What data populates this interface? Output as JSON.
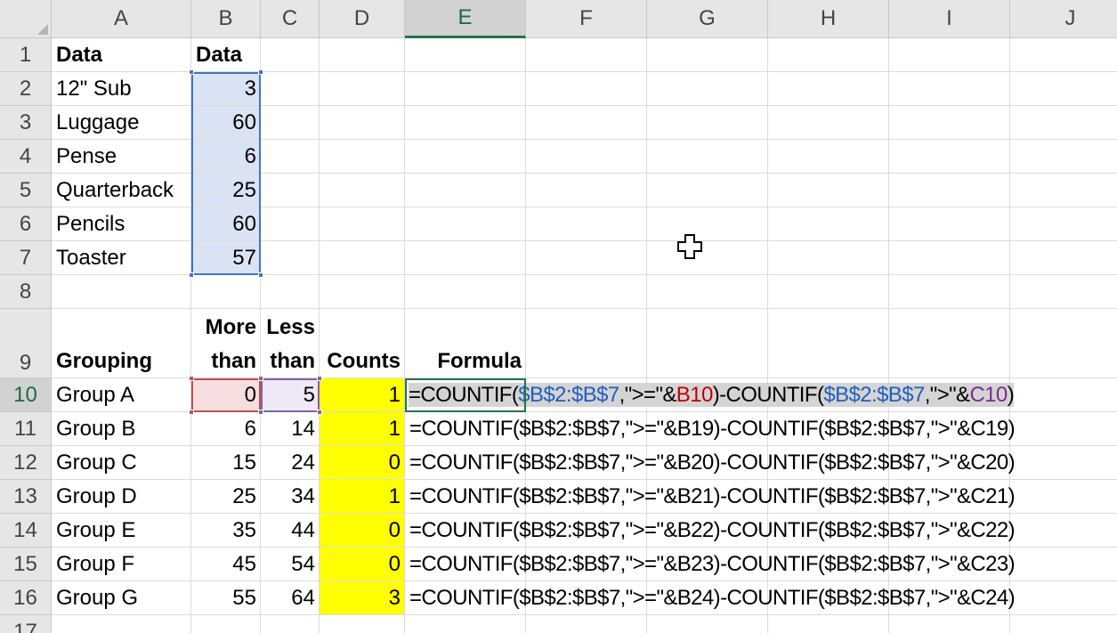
{
  "columns": [
    "A",
    "B",
    "C",
    "D",
    "E",
    "F",
    "G",
    "H",
    "I",
    "J"
  ],
  "rows": [
    "1",
    "2",
    "3",
    "4",
    "5",
    "6",
    "7",
    "8",
    "9",
    "10",
    "11",
    "12",
    "13",
    "14",
    "15",
    "16",
    "17"
  ],
  "selected": {
    "column": "E",
    "row": "10"
  },
  "data_header": {
    "a1": "Data",
    "b1": "Data"
  },
  "data_rows": [
    {
      "name": "12\" Sub",
      "value": "3"
    },
    {
      "name": "Luggage",
      "value": "60"
    },
    {
      "name": "Pense",
      "value": "6"
    },
    {
      "name": "Quarterback",
      "value": "25"
    },
    {
      "name": "Pencils",
      "value": "60"
    },
    {
      "name": "Toaster",
      "value": "57"
    }
  ],
  "group_header": {
    "grouping": "Grouping",
    "more_line1": "More",
    "more_line2": "than",
    "less_line1": "Less",
    "less_line2": "than",
    "counts": "Counts",
    "formula": "Formula"
  },
  "active_formula": {
    "p1": "=COUNTIF(",
    "r1": "$B$2:$B$7",
    "p2": ",\">=\"&",
    "r2": "B10",
    "p3": ")-COUNTIF(",
    "r3": "$B$2:$B$7",
    "p4": ",\">\"&",
    "r4": "C10",
    "p5": ")"
  },
  "groups": [
    {
      "name": "Group A",
      "more": "0",
      "less": "5",
      "count": "1",
      "formula": ""
    },
    {
      "name": "Group B",
      "more": "6",
      "less": "14",
      "count": "1",
      "formula": "=COUNTIF($B$2:$B$7,\">=\"&B19)-COUNTIF($B$2:$B$7,\">\"&C19)"
    },
    {
      "name": "Group C",
      "more": "15",
      "less": "24",
      "count": "0",
      "formula": "=COUNTIF($B$2:$B$7,\">=\"&B20)-COUNTIF($B$2:$B$7,\">\"&C20)"
    },
    {
      "name": "Group D",
      "more": "25",
      "less": "34",
      "count": "1",
      "formula": "=COUNTIF($B$2:$B$7,\">=\"&B21)-COUNTIF($B$2:$B$7,\">\"&C21)"
    },
    {
      "name": "Group E",
      "more": "35",
      "less": "44",
      "count": "0",
      "formula": "=COUNTIF($B$2:$B$7,\">=\"&B22)-COUNTIF($B$2:$B$7,\">\"&C22)"
    },
    {
      "name": "Group F",
      "more": "45",
      "less": "54",
      "count": "0",
      "formula": "=COUNTIF($B$2:$B$7,\">=\"&B23)-COUNTIF($B$2:$B$7,\">\"&C23)"
    },
    {
      "name": "Group G",
      "more": "55",
      "less": "64",
      "count": "3",
      "formula": "=COUNTIF($B$2:$B$7,\">=\"&B24)-COUNTIF($B$2:$B$7,\">\"&C24)"
    }
  ],
  "colors": {
    "counts_fill": "#ffff00",
    "data_range_fill": "#dae3f3",
    "ref_b10_fill": "#f6dede",
    "ref_c10_fill": "#efe8f6",
    "accent": "#217346"
  },
  "cursor": "cross-cursor-icon"
}
